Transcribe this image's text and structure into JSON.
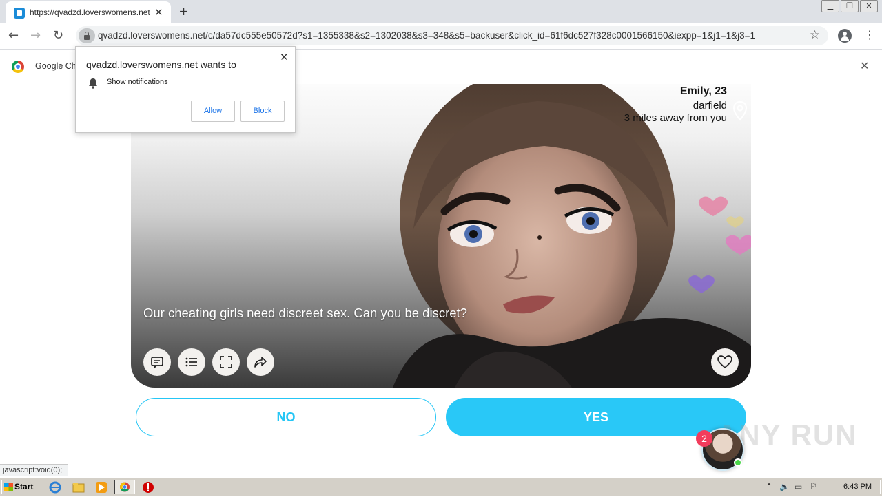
{
  "browser": {
    "tab_title": "https://qvadzd.loverswomens.net/c",
    "url": "qvadzd.loverswomens.net/c/da57dc555e50572d?s1=1355338&s2=1302038&s3=348&s5=backuser&click_id=61f6dc527f328c0001566150&iexpp=1&j1=1&j3=1",
    "infobar_text": "Google Ch"
  },
  "permission_prompt": {
    "title": "qvadzd.loverswomens.net wants to",
    "permission": "Show notifications",
    "allow_label": "Allow",
    "block_label": "Block"
  },
  "profile": {
    "name": "Emily, 23",
    "city": "darfield",
    "distance": "3 miles away from you",
    "tagline": "Our cheating girls need discreet sex. Can you be discret?"
  },
  "actions": {
    "no_label": "NO",
    "yes_label": "YES"
  },
  "chat": {
    "unread_count": "2"
  },
  "watermark": "ANY RUN",
  "status_bar": "javascript:void(0);",
  "taskbar": {
    "start_label": "Start",
    "clock": "6:43 PM"
  },
  "colors": {
    "accent": "#29c8f7",
    "badge": "#f23c5c",
    "online": "#49d649"
  }
}
